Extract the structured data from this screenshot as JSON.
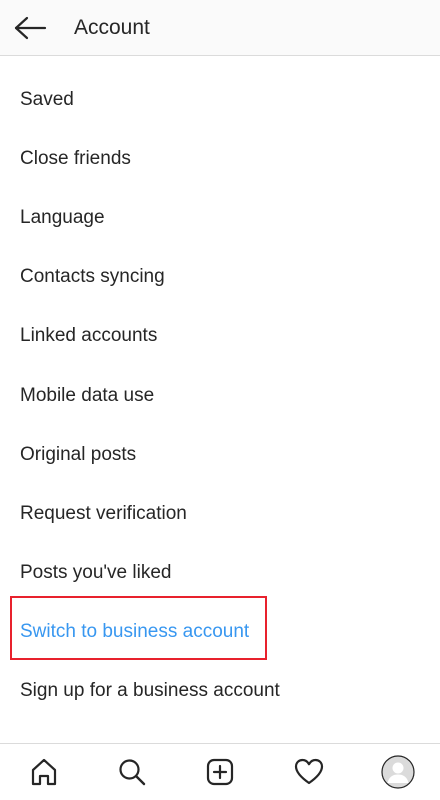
{
  "header": {
    "title": "Account",
    "back_icon": "arrow-left-icon"
  },
  "menu": {
    "items": [
      {
        "label": "Saved"
      },
      {
        "label": "Close friends"
      },
      {
        "label": "Language"
      },
      {
        "label": "Contacts syncing"
      },
      {
        "label": "Linked accounts"
      },
      {
        "label": "Mobile data use"
      },
      {
        "label": "Original posts"
      },
      {
        "label": "Request verification"
      },
      {
        "label": "Posts you've liked"
      },
      {
        "label": "Switch to business account",
        "accent": true,
        "highlighted": true
      },
      {
        "label": "Sign up for a business account"
      }
    ]
  },
  "tabbar": {
    "tabs": [
      {
        "icon": "home-icon"
      },
      {
        "icon": "search-icon"
      },
      {
        "icon": "add-post-icon"
      },
      {
        "icon": "heart-icon"
      },
      {
        "icon": "profile-avatar-icon"
      }
    ]
  },
  "colors": {
    "accent": "#3897f0",
    "highlight_border": "#e8212d",
    "text": "#262626",
    "divider": "#dbdbdb"
  }
}
